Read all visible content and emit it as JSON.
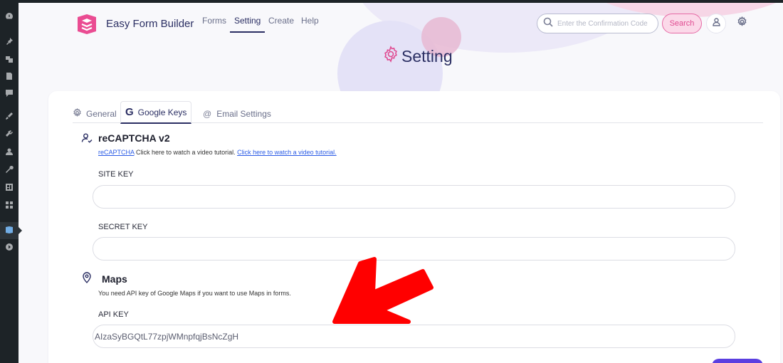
{
  "app": {
    "brand": "Easy Form Builder",
    "colors": {
      "accent": "#2b2f63",
      "pink": "#e04b91",
      "link": "#2b5ce6",
      "arrow": "#ff0000"
    }
  },
  "nav": {
    "tabs": [
      {
        "label": "Forms"
      },
      {
        "label": "Setting"
      },
      {
        "label": "Create"
      },
      {
        "label": "Help"
      }
    ],
    "active": "Setting"
  },
  "search": {
    "placeholder": "Enter the Confirmation Code",
    "button_label": "Search"
  },
  "header_icons": [
    "user-icon",
    "gear-icon"
  ],
  "page": {
    "title": "Setting"
  },
  "settings_tabs": [
    {
      "label": "General",
      "icon": "gear-icon"
    },
    {
      "label": "Google Keys",
      "icon": "google-icon"
    },
    {
      "label": "Email Settings",
      "icon": "at-icon"
    }
  ],
  "recaptcha": {
    "title": "reCAPTCHA v2",
    "help_link_1": "reCAPTCHA",
    "help_text": " Click here to watch a video tutorial. ",
    "help_link_2": "Click here to watch a video tutorial.",
    "site_key_label": "SITE KEY",
    "site_key_value": "",
    "secret_key_label": "SECRET KEY",
    "secret_key_value": ""
  },
  "maps": {
    "title": "Maps",
    "help_text": "You need API key of Google Maps if you want to use Maps in forms.",
    "api_key_label": "API KEY",
    "api_key_value": "AIzaSyBGQtL77zpjWMnpfqjBsNcZgH"
  }
}
